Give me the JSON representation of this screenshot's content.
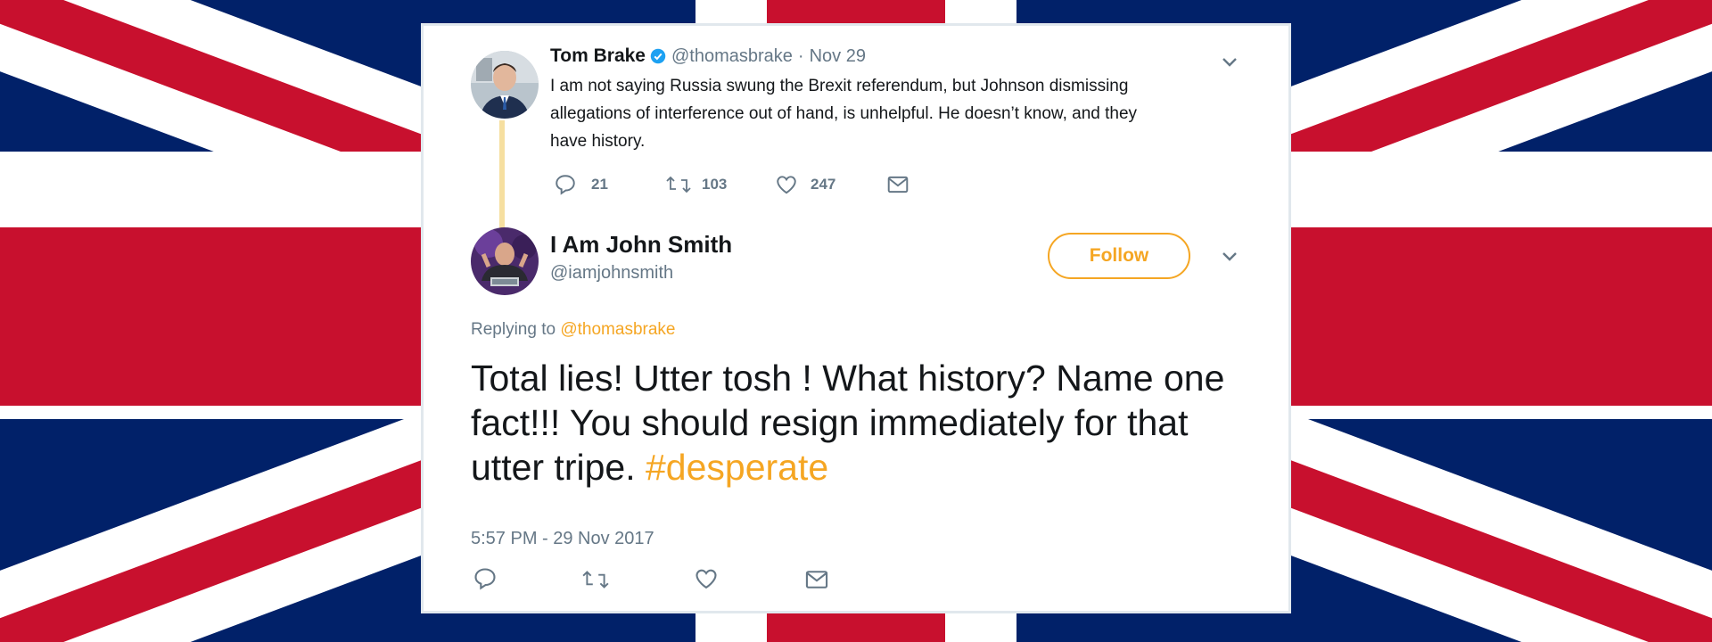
{
  "colors": {
    "flag_blue": "#012169",
    "flag_red": "#c8102e",
    "accent": "#f5a623",
    "verified": "#1da1f2",
    "muted": "#657786"
  },
  "parent_tweet": {
    "name": "Tom Brake",
    "verified_icon": "verified-badge-icon",
    "handle": "@thomasbrake",
    "separator": "·",
    "date": "Nov 29",
    "text_lines": [
      "I am not saying Russia swung the Brexit referendum, but Johnson dismissing",
      "allegations of interference out of hand, is unhelpful. He doesn’t know, and they",
      "have history."
    ],
    "actions": {
      "reply_count": "21",
      "retweet_count": "103",
      "like_count": "247"
    }
  },
  "reply_tweet": {
    "name": "I Am John Smith",
    "handle": "@iamjohnsmith",
    "follow_label": "Follow",
    "replying_to_prefix": "Replying to",
    "replying_to_handle": "@thomasbrake",
    "text": "Total lies! Utter tosh ! What history? Name one fact!!! You should resign immediately for that utter tripe.",
    "hashtag": "#desperate",
    "timestamp": "5:57 PM - 29 Nov 2017"
  },
  "icons": [
    "reply-icon",
    "retweet-icon",
    "like-icon",
    "message-icon",
    "chevron-down-icon",
    "verified-badge-icon"
  ]
}
